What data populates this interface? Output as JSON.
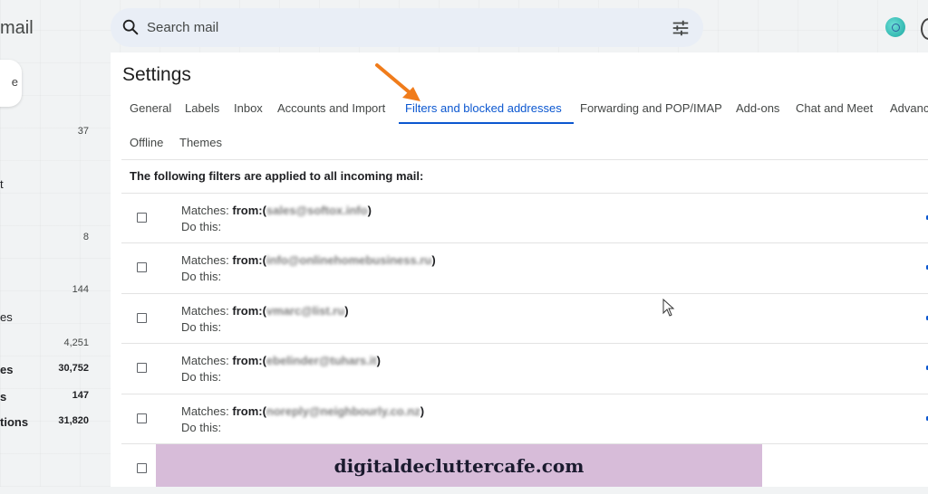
{
  "brand": "mail",
  "compose_label": "e",
  "sidebar": [
    {
      "label": "",
      "count": "37"
    },
    {
      "label": "t",
      "count": ""
    },
    {
      "label": "",
      "count": "8"
    },
    {
      "label": "",
      "count": "144"
    },
    {
      "label": "es",
      "count": ""
    },
    {
      "label": "",
      "count": "4,251"
    },
    {
      "label": "es",
      "count": "30,752",
      "bold": true
    },
    {
      "label": "s",
      "count": "147",
      "bold": true
    },
    {
      "label": "tions",
      "count": "31,820",
      "bold": true
    }
  ],
  "search": {
    "placeholder": "Search mail"
  },
  "settings": {
    "title": "Settings",
    "tabs": [
      "General",
      "Labels",
      "Inbox",
      "Accounts and Import",
      "Filters and blocked addresses",
      "Forwarding and POP/IMAP",
      "Add-ons",
      "Chat and Meet",
      "Advanc"
    ],
    "active_tab": "Filters and blocked addresses",
    "tabs_row2": [
      "Offline",
      "Themes"
    ],
    "intro": "The following filters are applied to all incoming mail:",
    "filters": [
      {
        "prefix": "Matches: ",
        "from_label": "from:(",
        "address": "sales@softox.info",
        "suffix": ")",
        "action": "Do this:"
      },
      {
        "prefix": "Matches: ",
        "from_label": "from:(",
        "address": "info@onlinehomebusiness.ru",
        "suffix": ")",
        "action": "Do this:"
      },
      {
        "prefix": "Matches: ",
        "from_label": "from:(",
        "address": "vmarc@list.ru",
        "suffix": ")",
        "action": "Do this:"
      },
      {
        "prefix": "Matches: ",
        "from_label": "from:(",
        "address": "ebelinder@tuhars.it",
        "suffix": ")",
        "action": "Do this:"
      },
      {
        "prefix": "Matches: ",
        "from_label": "from:(",
        "address": "noreply@neighbourly.co.nz",
        "suffix": ")",
        "action": "Do this:"
      },
      {
        "prefix": "",
        "from_label": "",
        "address": "",
        "suffix": "",
        "action": ""
      }
    ]
  },
  "watermark": "digitaldecluttercafe.com",
  "colors": {
    "accent": "#0b57d0",
    "arrow": "#f07c1b",
    "watermark_bg": "#d7bcd9"
  }
}
